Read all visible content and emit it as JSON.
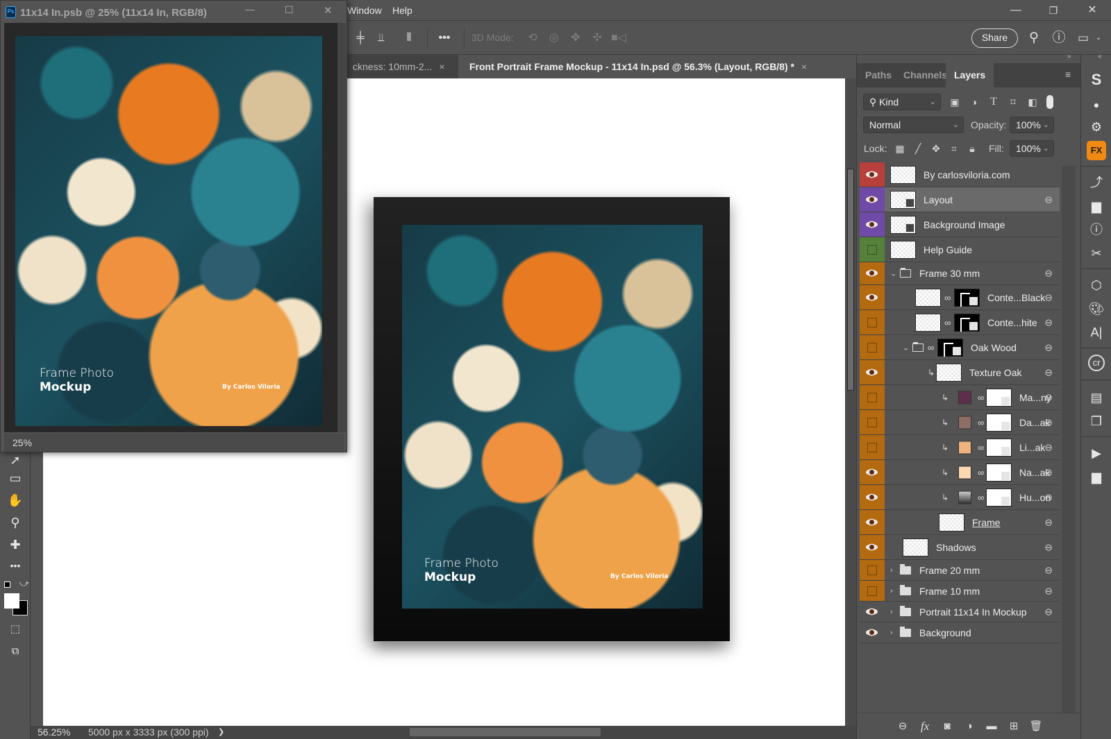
{
  "app": {
    "menu": [
      "Window",
      "Help"
    ],
    "window_controls": {
      "minimize": "—",
      "restore": "❐",
      "close": "✕"
    }
  },
  "options_bar": {
    "mode_label": "3D Mode:",
    "share_label": "Share",
    "more_label": "•••"
  },
  "floating_window": {
    "icon_label": "Ps",
    "title": "11x14 In.psb @ 25% (11x14 In, RGB/8)",
    "zoom": "25%",
    "artwork": {
      "title_line1": "Frame Photo",
      "title_line2": "Mockup",
      "credit": "By Carlos Viloria"
    }
  },
  "tabs": [
    {
      "label": "ckness: 10mm-2...",
      "close": "×",
      "active": false
    },
    {
      "label": "Front Portrait Frame Mockup - 11x14 In.psd @ 56.3% (Layout, RGB/8) *",
      "close": "×",
      "active": true
    }
  ],
  "canvas": {
    "artwork": {
      "title_line1": "Frame Photo",
      "title_line2": "Mockup",
      "credit": "By Carlos Viloria"
    }
  },
  "status": {
    "zoom": "56.25%",
    "doc_info": "5000 px x 3333 px (300 ppi)",
    "arrow": "❯"
  },
  "panel": {
    "tabs": [
      {
        "label": "Paths",
        "active": false
      },
      {
        "label": "Channels",
        "active": false
      },
      {
        "label": "Layers",
        "active": true
      }
    ],
    "filter": {
      "label": "Kind"
    },
    "blend_mode": "Normal",
    "opacity_label": "Opacity:",
    "opacity": "100%",
    "lock_label": "Lock:",
    "fill_label": "Fill:",
    "fill": "100%",
    "layers": [
      {
        "name": "By carlosviloria.com",
        "visible": true,
        "color": "#b7403d",
        "indent": 0,
        "kind": "pixel",
        "selected": false,
        "linked": false
      },
      {
        "name": "Layout",
        "visible": true,
        "color": "#6f4aa6",
        "indent": 0,
        "kind": "smart",
        "selected": true,
        "linked": true
      },
      {
        "name": "Background Image",
        "visible": true,
        "color": "#6f4aa6",
        "indent": 0,
        "kind": "smart",
        "selected": false,
        "linked": false
      },
      {
        "name": "Help Guide",
        "visible": false,
        "color": "#56813a",
        "indent": 0,
        "kind": "pixel",
        "selected": false,
        "linked": false
      },
      {
        "name": "Frame 30 mm",
        "visible": true,
        "color": "#b36a10",
        "indent": 0,
        "kind": "group-open",
        "selected": false,
        "linked": true
      },
      {
        "name": "Conte...Black",
        "visible": true,
        "color": "#b36a10",
        "indent": 1,
        "kind": "pixel-mask",
        "selected": false,
        "linked": true
      },
      {
        "name": "Conte...hite",
        "visible": false,
        "color": "#b36a10",
        "indent": 1,
        "kind": "pixel-mask",
        "selected": false,
        "linked": true
      },
      {
        "name": "Oak Wood",
        "visible": false,
        "color": "#b36a10",
        "indent": 1,
        "kind": "group-mask",
        "selected": false,
        "linked": true
      },
      {
        "name": "Texture Oak",
        "visible": true,
        "color": "#b36a10",
        "indent": 2,
        "kind": "clip-pixel",
        "selected": false,
        "linked": true
      },
      {
        "name": "Ma...ny",
        "visible": false,
        "color": "#b36a10",
        "indent": 2,
        "kind": "clip-fill",
        "swatch": "#5e2f4a",
        "selected": false,
        "linked": true
      },
      {
        "name": "Da...ak",
        "visible": false,
        "color": "#b36a10",
        "indent": 2,
        "kind": "clip-fill",
        "swatch": "#8e6d66",
        "selected": false,
        "linked": true
      },
      {
        "name": "Li...ak",
        "visible": false,
        "color": "#b36a10",
        "indent": 2,
        "kind": "clip-fill",
        "swatch": "#f0b37f",
        "selected": false,
        "linked": true
      },
      {
        "name": "Na...ak",
        "visible": true,
        "color": "#b36a10",
        "indent": 2,
        "kind": "clip-fill",
        "swatch": "#fdd8b2",
        "selected": false,
        "linked": true
      },
      {
        "name": "Hu...on",
        "visible": true,
        "color": "#b36a10",
        "indent": 2,
        "kind": "clip-adjust",
        "selected": false,
        "linked": true
      },
      {
        "name": "Frame",
        "visible": true,
        "color": "#b36a10",
        "indent": 2,
        "kind": "frame",
        "selected": false,
        "linked": true,
        "underline": true
      },
      {
        "name": "Shadows",
        "visible": true,
        "color": "#b36a10",
        "indent": 1,
        "kind": "pixel",
        "selected": false,
        "linked": true
      },
      {
        "name": "Frame 20 mm",
        "visible": false,
        "color": "#b36a10",
        "indent": 0,
        "kind": "group",
        "selected": false,
        "linked": true
      },
      {
        "name": "Frame 10 mm",
        "visible": false,
        "color": "#b36a10",
        "indent": 0,
        "kind": "group",
        "selected": false,
        "linked": true
      },
      {
        "name": "Portrait 11x14 In Mockup",
        "visible": true,
        "color": "",
        "indent": 0,
        "kind": "group",
        "selected": false,
        "linked": true
      },
      {
        "name": "Background",
        "visible": true,
        "color": "",
        "indent": 0,
        "kind": "group",
        "selected": false,
        "linked": false
      }
    ]
  }
}
